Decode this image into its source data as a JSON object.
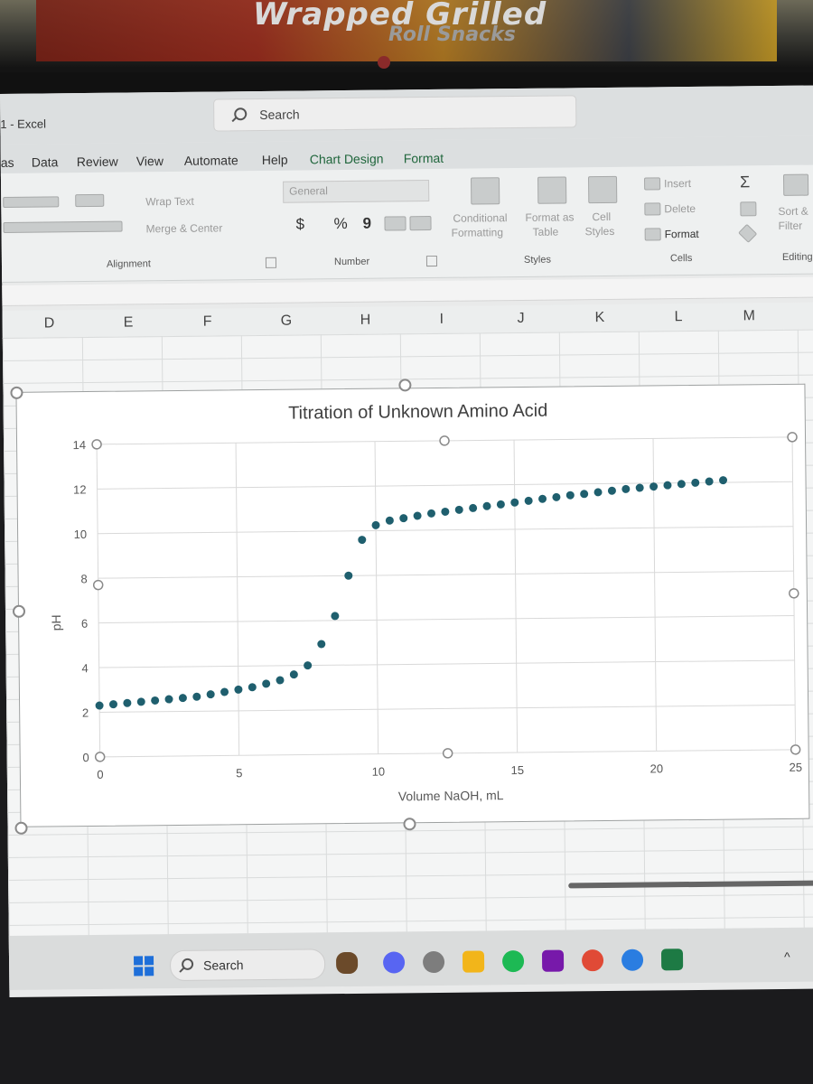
{
  "photo_background": {
    "poster_text": "Wrapped Grilled",
    "poster_text2": "Roll Snacks"
  },
  "app": {
    "title": "1 - Excel",
    "search_placeholder": "Search"
  },
  "menu": {
    "items": [
      "as",
      "Data",
      "Review",
      "View",
      "Automate",
      "Help",
      "Chart Design",
      "Format"
    ],
    "active": "Chart Design"
  },
  "ribbon": {
    "wrap_text": "Wrap Text",
    "merge_center": "Merge & Center",
    "alignment_group": "Alignment",
    "number_format": "General",
    "dollar": "$",
    "percent": "%",
    "comma": "9",
    "number_group": "Number",
    "conditional_formatting": [
      "Conditional",
      "Formatting"
    ],
    "format_as_table": [
      "Format as",
      "Table"
    ],
    "cell_styles": [
      "Cell",
      "Styles"
    ],
    "styles_group": "Styles",
    "insert": "Insert",
    "delete": "Delete",
    "format": "Format",
    "cells_group": "Cells",
    "sort_filter": [
      "Sort &",
      "Filter"
    ],
    "editing_group": "Editing",
    "sum_symbol": "Σ"
  },
  "columns": [
    "D",
    "E",
    "F",
    "G",
    "H",
    "I",
    "J",
    "K",
    "L",
    "M"
  ],
  "taskbar": {
    "search_label": "Search",
    "tray_chevron": "^"
  },
  "colors": {
    "marker": "#1f5f6e",
    "accent_green": "#20663c",
    "gridline": "#d9d9d9"
  },
  "chart_data": {
    "type": "scatter",
    "title": "Titration of Unknown Amino Acid",
    "xlabel": "Volume NaOH, mL",
    "ylabel": "pH",
    "xlim": [
      0,
      25
    ],
    "ylim": [
      0,
      14
    ],
    "xticks": [
      0,
      5,
      10,
      15,
      20,
      25
    ],
    "yticks": [
      0,
      2,
      4,
      6,
      8,
      10,
      12,
      14
    ],
    "grid": true,
    "legend": "none",
    "series": [
      {
        "x": [
          0,
          0.5,
          1.0,
          1.5,
          2.0,
          2.5,
          3.0,
          3.5,
          4.0,
          4.5,
          5.0,
          5.5,
          6.0,
          6.5,
          7.0,
          7.5,
          8.0,
          8.5,
          9.0,
          9.5,
          10.0,
          10.5,
          11.0,
          11.5,
          12.0,
          12.5,
          13.0,
          13.5,
          14.0,
          14.5,
          15.0,
          15.5,
          16.0,
          16.5,
          17.0,
          17.5,
          18.0,
          18.5,
          19.0,
          19.5,
          20.0,
          20.5,
          21.0,
          21.5,
          22.0,
          22.5
        ],
        "y": [
          2.3,
          2.35,
          2.4,
          2.45,
          2.5,
          2.55,
          2.6,
          2.65,
          2.75,
          2.85,
          2.95,
          3.05,
          3.2,
          3.35,
          3.6,
          4.0,
          4.95,
          6.2,
          8.0,
          9.6,
          10.25,
          10.45,
          10.55,
          10.65,
          10.75,
          10.82,
          10.9,
          10.97,
          11.05,
          11.12,
          11.2,
          11.27,
          11.35,
          11.42,
          11.5,
          11.55,
          11.62,
          11.68,
          11.75,
          11.8,
          11.85,
          11.9,
          11.95,
          12.0,
          12.05,
          12.1
        ]
      }
    ]
  }
}
